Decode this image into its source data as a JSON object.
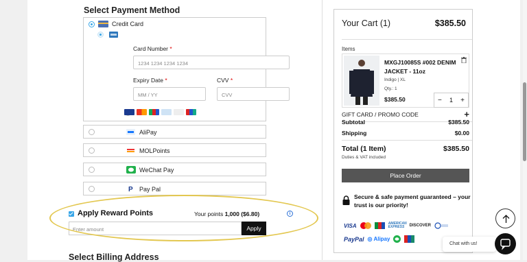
{
  "payment": {
    "title": "Select Payment Method",
    "credit_card": {
      "label": "Credit Card",
      "card_number_label": "Card Number",
      "card_number_placeholder": "1234 1234 1234 1234",
      "expiry_label": "Expiry Date",
      "expiry_placeholder": "MM / YY",
      "cvv_label": "CVV",
      "cvv_placeholder": "CVV",
      "required_mark": "*"
    },
    "options": [
      {
        "label": "AliPay",
        "icon": "alipay-icon"
      },
      {
        "label": "MOLPoints",
        "icon": "molpoints-icon"
      },
      {
        "label": "WeChat Pay",
        "icon": "wechat-icon"
      },
      {
        "label": "Pay Pal",
        "icon": "paypal-icon"
      }
    ]
  },
  "reward": {
    "title": "Apply Reward Points",
    "points_prefix": "Your points",
    "points_value": "1,000 ($6.80)",
    "amount_placeholder": "Enter amount",
    "apply_label": "Apply"
  },
  "billing": {
    "title": "Select Billing Address"
  },
  "cart": {
    "title": "Your Cart (1)",
    "total_top": "$385.50",
    "items_label": "Items",
    "item": {
      "name": "MXGJ10085S #002 DENIM JACKET - 11oz",
      "variant": "Indigo | XL",
      "qty_text": "Qty.: 1",
      "price": "$385.50",
      "qty": "1",
      "minus": "−",
      "plus": "+"
    },
    "gift_label": "GIFT CARD / PROMO CODE",
    "gift_plus": "+",
    "subtotal_label": "Subtotal",
    "subtotal_value": "$385.50",
    "shipping_label": "Shipping",
    "shipping_value": "$0.00",
    "total_label": "Total (1 Item)",
    "total_value": "$385.50",
    "duties": "Duties & VAT included",
    "place_order": "Place Order",
    "secure_text": "Secure & safe payment guaranteed – your trust is our priority!",
    "logos_row1": [
      "VISA",
      "mastercard",
      "JCB",
      "AMERICAN EXPRESS",
      "DISCOVER",
      "Diners Club"
    ],
    "logos_row2": [
      "PayPal",
      "Alipay",
      "WeChat",
      "UnionPay"
    ]
  },
  "chat": {
    "label": "Chat with us!"
  },
  "colors": {
    "accent": "#38a6e8",
    "highlight": "#e3c74f",
    "button_dark": "#111111",
    "place_order": "#555555"
  }
}
